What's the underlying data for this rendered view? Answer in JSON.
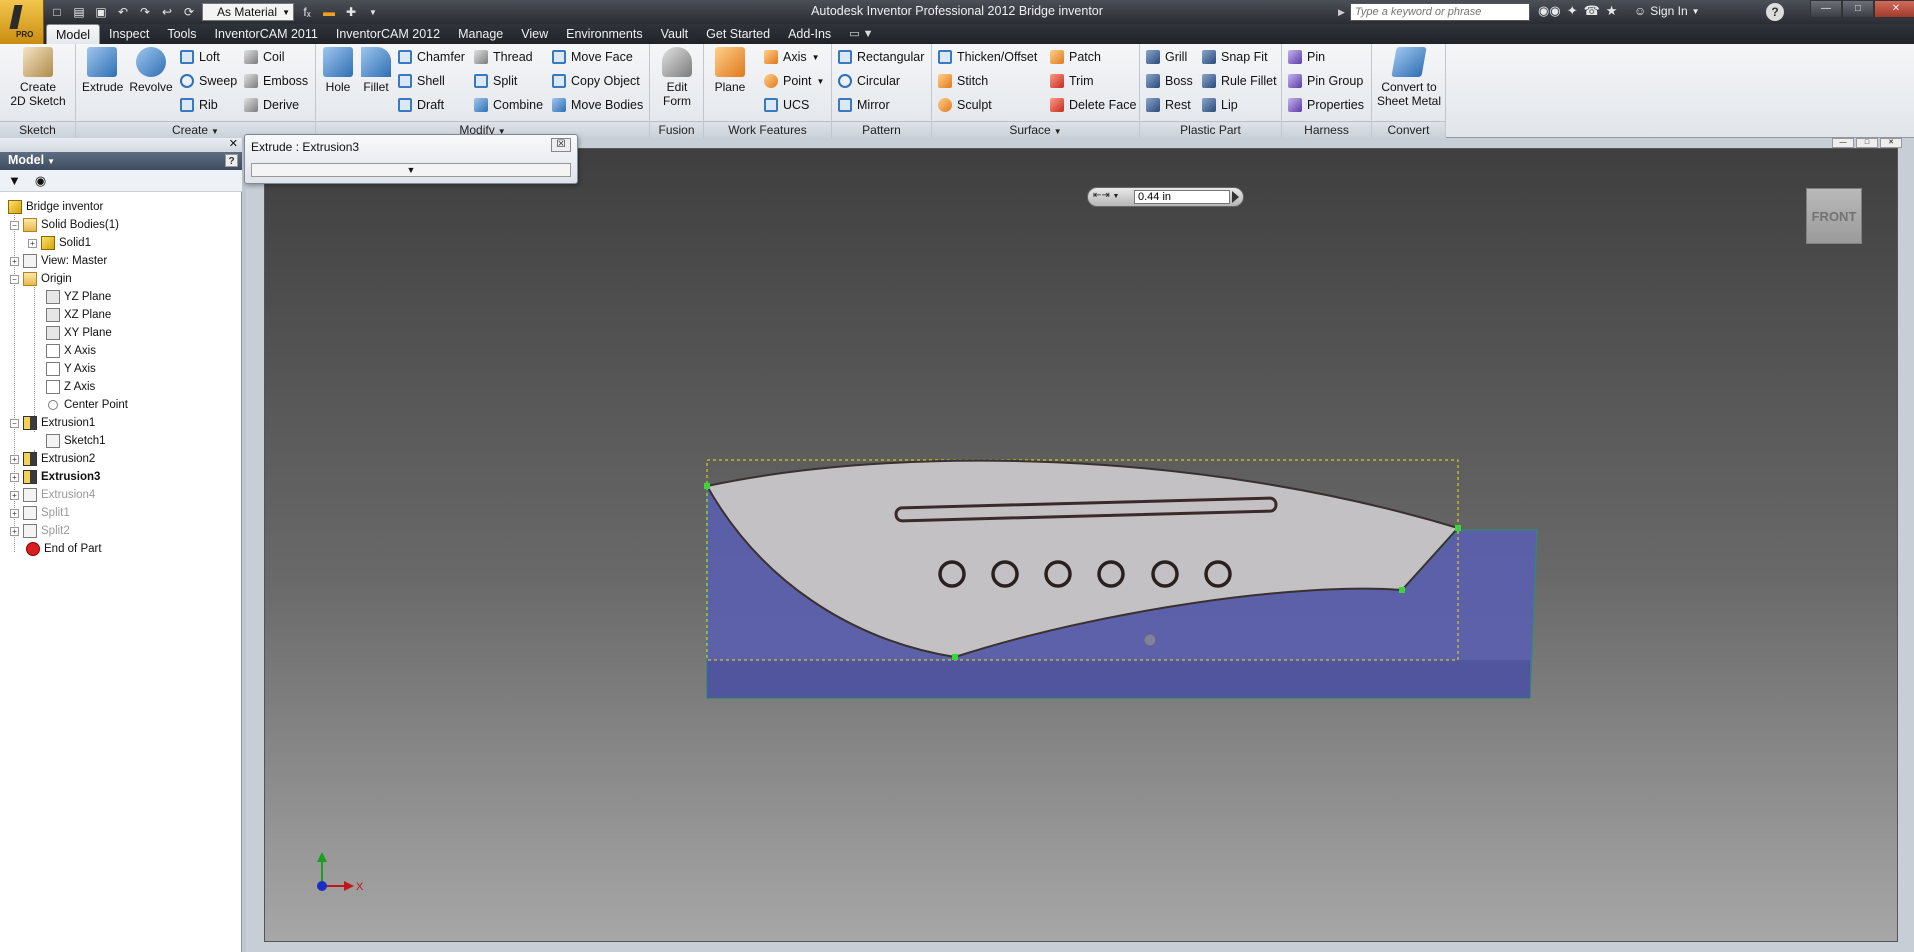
{
  "window": {
    "title": "Autodesk Inventor Professional 2012   Bridge inventor",
    "search_placeholder": "Type a keyword or phrase",
    "sign_in": "Sign In",
    "help": "?"
  },
  "qat": {
    "material": "As Material",
    "formula_icon": "fₓ"
  },
  "tabs": [
    "Model",
    "Inspect",
    "Tools",
    "InventorCAM 2011",
    "InventorCAM 2012",
    "Manage",
    "View",
    "Environments",
    "Vault",
    "Get Started",
    "Add-Ins"
  ],
  "ribbon": {
    "sketch": {
      "label": "Sketch",
      "create_2d_line1": "Create",
      "create_2d_line2": "2D Sketch"
    },
    "create": {
      "label": "Create",
      "extrude": "Extrude",
      "revolve": "Revolve",
      "loft": "Loft",
      "sweep": "Sweep",
      "rib": "Rib",
      "coil": "Coil",
      "emboss": "Emboss",
      "derive": "Derive"
    },
    "modify": {
      "label": "Modify",
      "hole": "Hole",
      "fillet": "Fillet",
      "chamfer": "Chamfer",
      "shell": "Shell",
      "draft": "Draft",
      "thread": "Thread",
      "split": "Split",
      "combine": "Combine",
      "move_face": "Move Face",
      "copy_object": "Copy Object",
      "move_bodies": "Move Bodies"
    },
    "fusion": {
      "label": "Fusion",
      "edit_form_line1": "Edit",
      "edit_form_line2": "Form"
    },
    "work_features": {
      "label": "Work Features",
      "plane": "Plane",
      "axis": "Axis",
      "point": "Point",
      "ucs": "UCS"
    },
    "pattern": {
      "label": "Pattern",
      "rectangular": "Rectangular",
      "circular": "Circular",
      "mirror": "Mirror"
    },
    "surface": {
      "label": "Surface",
      "thicken": "Thicken/Offset",
      "stitch": "Stitch",
      "sculpt": "Sculpt",
      "patch": "Patch",
      "trim": "Trim",
      "delete_face": "Delete Face"
    },
    "plastic_part": {
      "label": "Plastic Part",
      "grill": "Grill",
      "boss": "Boss",
      "rest": "Rest",
      "snap_fit": "Snap Fit",
      "rule_fillet": "Rule Fillet",
      "lip": "Lip"
    },
    "harness": {
      "label": "Harness",
      "pin": "Pin",
      "pin_group": "Pin Group",
      "properties": "Properties"
    },
    "convert": {
      "label": "Convert",
      "line1": "Convert to",
      "line2": "Sheet Metal"
    }
  },
  "browser": {
    "title": "Model",
    "help": "?",
    "tree": [
      {
        "label": "Bridge inventor",
        "style": "normal"
      },
      {
        "label": "Solid Bodies(1)",
        "style": "normal"
      },
      {
        "label": "Solid1",
        "style": "normal"
      },
      {
        "label": "View: Master",
        "style": "normal"
      },
      {
        "label": "Origin",
        "style": "normal"
      },
      {
        "label": "YZ Plane",
        "style": "normal"
      },
      {
        "label": "XZ Plane",
        "style": "normal"
      },
      {
        "label": "XY Plane",
        "style": "normal"
      },
      {
        "label": "X Axis",
        "style": "normal"
      },
      {
        "label": "Y Axis",
        "style": "normal"
      },
      {
        "label": "Z Axis",
        "style": "normal"
      },
      {
        "label": "Center Point",
        "style": "normal"
      },
      {
        "label": "Extrusion1",
        "style": "normal"
      },
      {
        "label": "Sketch1",
        "style": "normal"
      },
      {
        "label": "Extrusion2",
        "style": "normal"
      },
      {
        "label": "Extrusion3",
        "style": "bold"
      },
      {
        "label": "Extrusion4",
        "style": "dim"
      },
      {
        "label": "Split1",
        "style": "dim"
      },
      {
        "label": "Split2",
        "style": "dim"
      },
      {
        "label": "End of Part",
        "style": "normal"
      }
    ]
  },
  "dialog": {
    "title": "Extrude : Extrusion3",
    "close": "☒"
  },
  "extrusion": {
    "distance": "0.44 in"
  },
  "viewcube": {
    "face": "FRONT"
  },
  "triad": {
    "x": "X"
  },
  "colors": {
    "accent": "#2f6fb4",
    "extrusion_fill": "#5a5fb0",
    "selection": "#e8e800"
  }
}
